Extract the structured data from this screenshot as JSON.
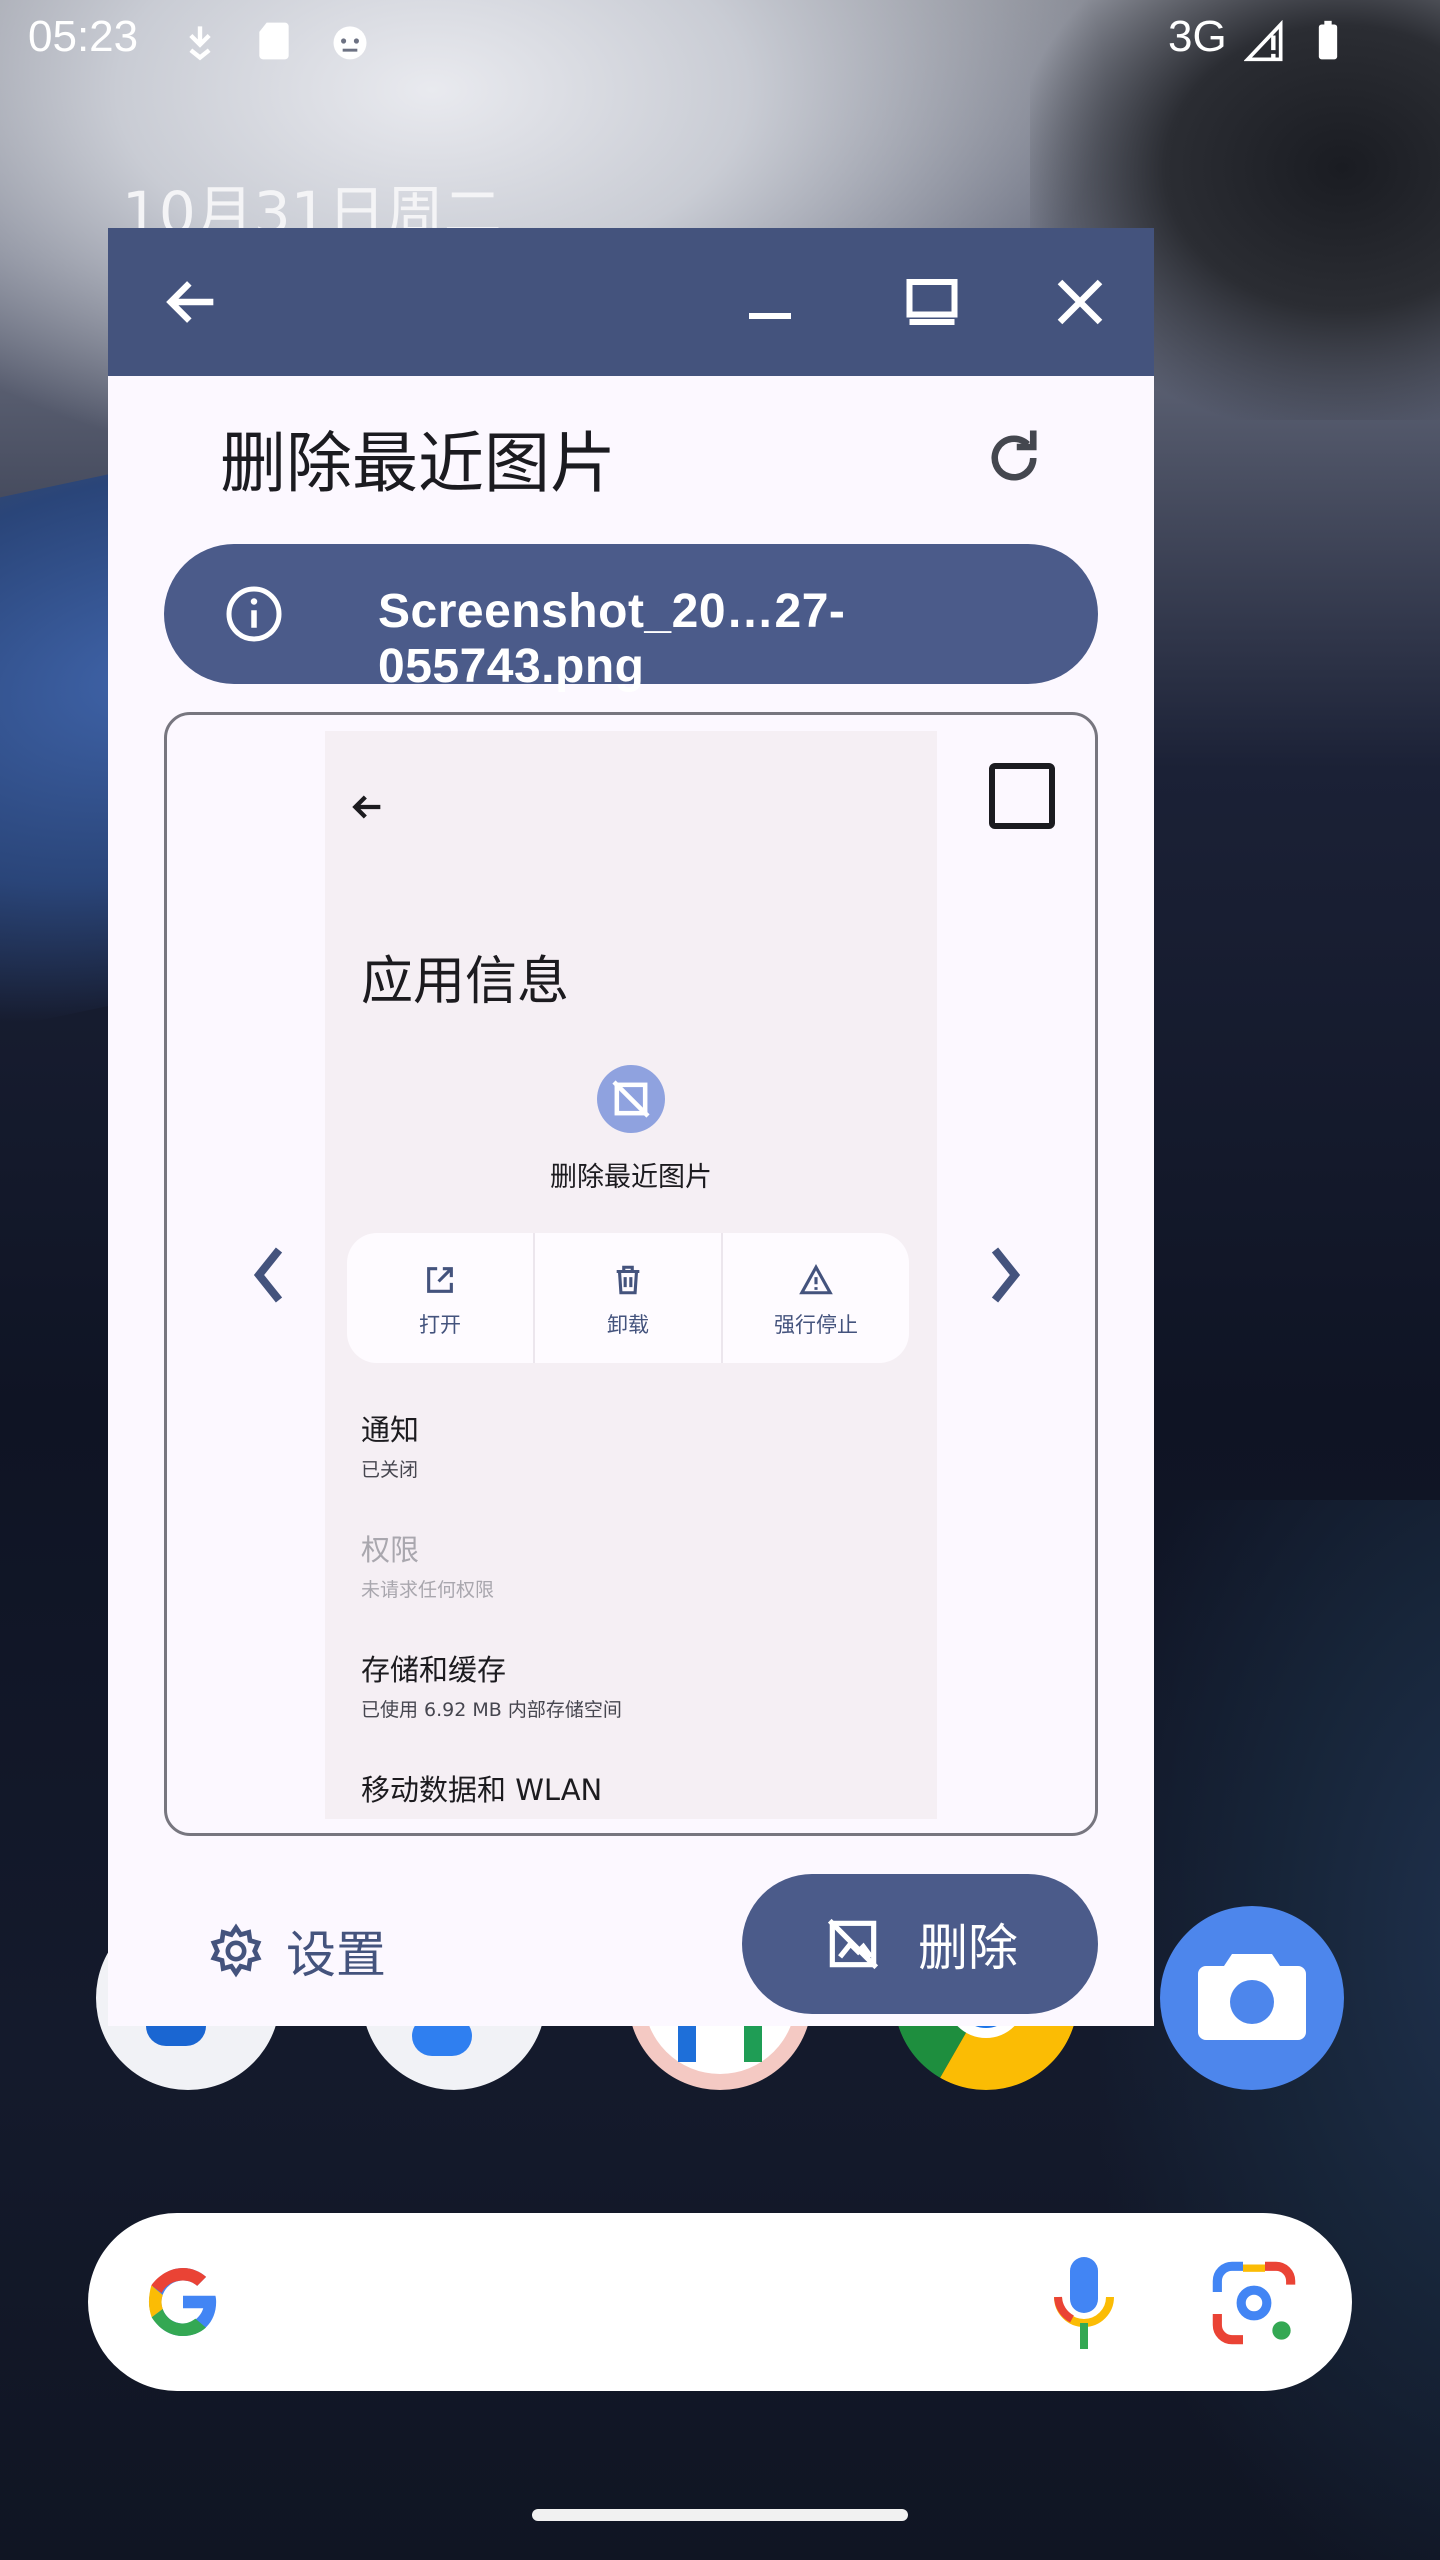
{
  "status_bar": {
    "time": "05:23",
    "network": "3G",
    "icons": [
      "download-icon",
      "sd-card-icon",
      "android-debug-icon",
      "signal-icon",
      "battery-icon"
    ]
  },
  "home": {
    "date": "10月31日周二"
  },
  "window": {
    "titlebar_buttons": [
      "back-icon",
      "minimize-icon",
      "maximize-icon",
      "close-icon"
    ],
    "app_title": "删除最近图片",
    "file_name": "Screenshot_20…27-055743.png",
    "preview": {
      "title": "应用信息",
      "app_name": "删除最近图片",
      "actions": [
        {
          "icon": "open-external-icon",
          "label": "打开"
        },
        {
          "icon": "trash-icon",
          "label": "卸载"
        },
        {
          "icon": "warning-icon",
          "label": "强行停止"
        }
      ],
      "rows": [
        {
          "title": "通知",
          "subtitle": "已关闭",
          "disabled": false
        },
        {
          "title": "权限",
          "subtitle": "未请求任何权限",
          "disabled": true
        },
        {
          "title": "存储和缓存",
          "subtitle": "已使用 6.92 MB 内部存储空间",
          "disabled": false
        },
        {
          "title": "移动数据和 WLAN",
          "subtitle": "",
          "disabled": false
        }
      ]
    },
    "settings_label": "设置",
    "delete_label": "删除"
  },
  "colors": {
    "titlebar": "#44537d",
    "primary": "#4b5b8a",
    "camera": "#4d86ec"
  }
}
